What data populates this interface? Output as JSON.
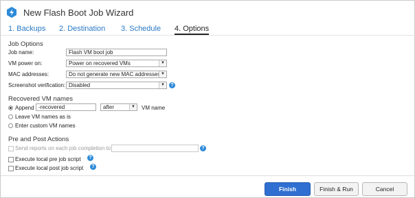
{
  "window": {
    "title": "New Flash Boot Job Wizard"
  },
  "tabs": [
    {
      "label": "1. Backups"
    },
    {
      "label": "2. Destination"
    },
    {
      "label": "3. Schedule"
    },
    {
      "label": "4. Options"
    }
  ],
  "job_options": {
    "section_title": "Job Options",
    "job_name": {
      "label": "Job name:",
      "value": "Flash VM boot job"
    },
    "vm_power_on": {
      "label": "VM power on:",
      "value": "Power on recovered VMs"
    },
    "mac_addresses": {
      "label": "MAC addresses:",
      "value": "Do not generate new MAC addresses"
    },
    "screenshot_verification": {
      "label": "Screenshot verification:",
      "value": "Disabled"
    }
  },
  "recovered_vm_names": {
    "section_title": "Recovered VM names",
    "append_label": "Append",
    "append_value": "-recovered",
    "position_value": "after",
    "vm_name_label": "VM name",
    "leave_label": "Leave VM names as is",
    "custom_label": "Enter custom VM names"
  },
  "pre_post": {
    "section_title": "Pre and Post Actions",
    "send_reports_label": "Send reports on each job completion to:",
    "pre_script_label": "Execute local pre job script",
    "post_script_label": "Execute local post job script"
  },
  "buttons": {
    "finish": "Finish",
    "finish_run": "Finish & Run",
    "cancel": "Cancel"
  },
  "colors": {
    "accent": "#2f6fd1",
    "tab_link": "#2a78c6",
    "help_icon": "#2d8ad8"
  }
}
